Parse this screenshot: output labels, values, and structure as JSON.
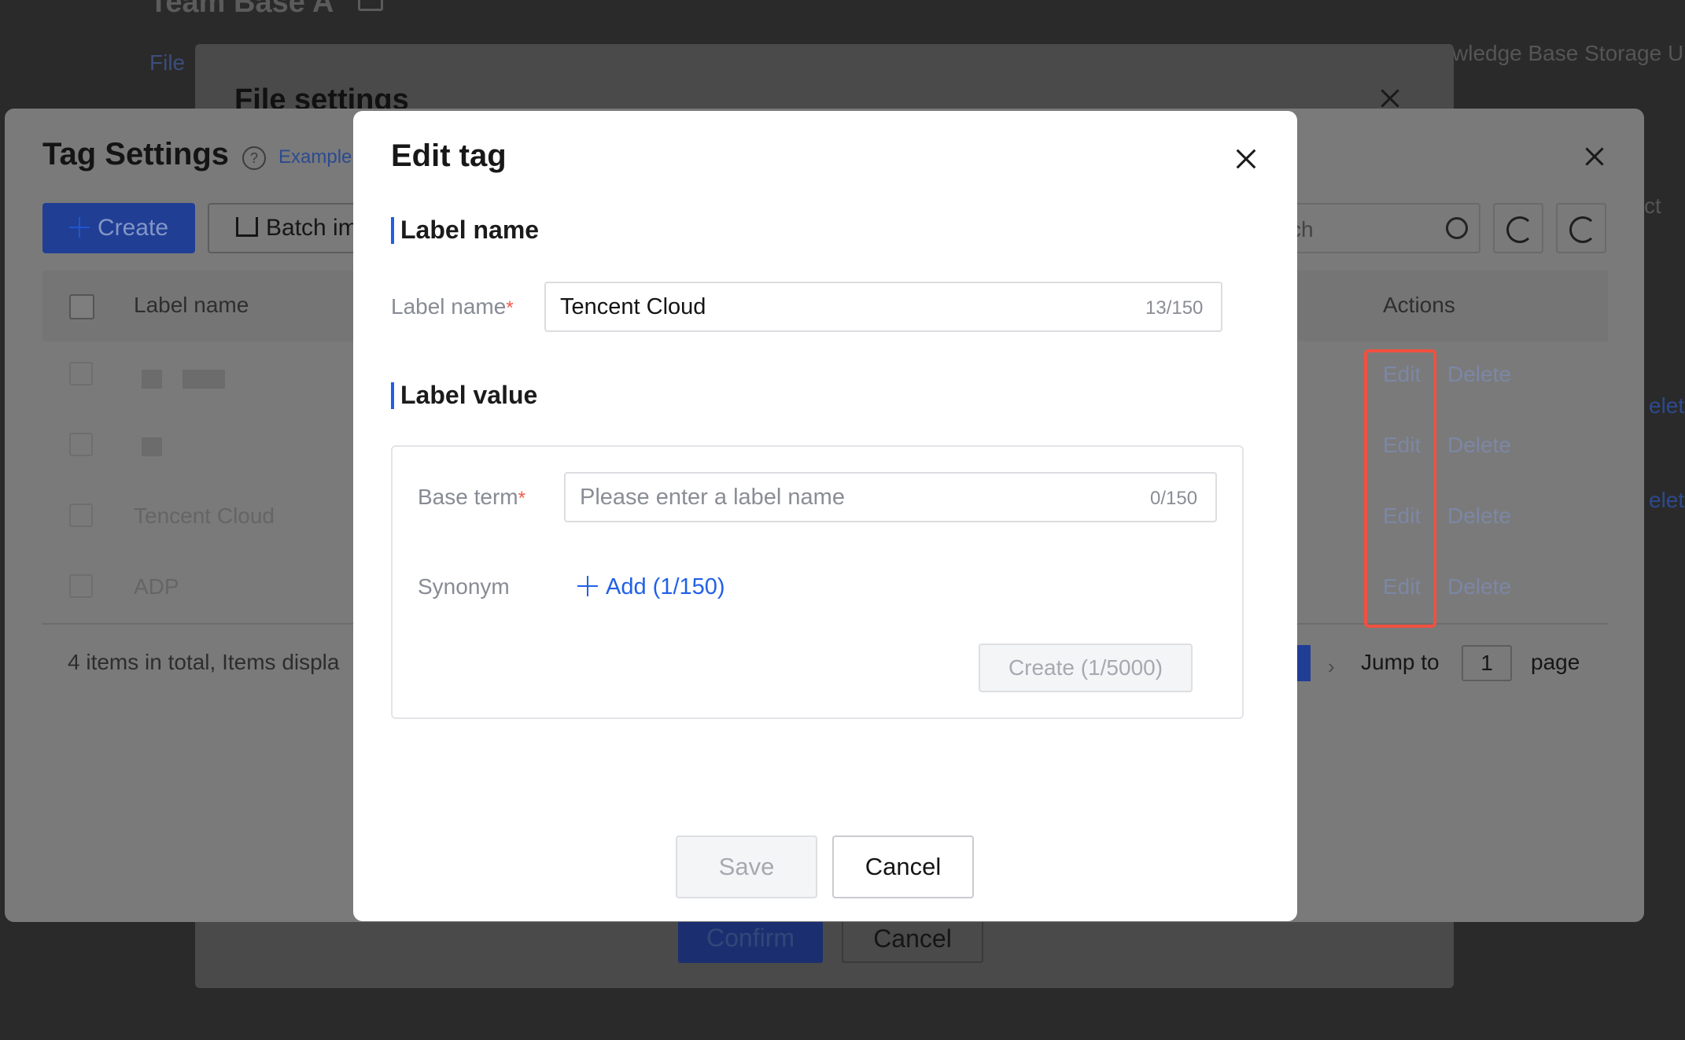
{
  "background": {
    "page_title": "Team Base A",
    "tab_file": "File",
    "right_text": "wledge Base Storage U"
  },
  "file_settings": {
    "title": "File settings",
    "confirm_label": "Confirm",
    "cancel_label": "Cancel"
  },
  "tag_settings": {
    "title": "Tag Settings",
    "help_glyph": "?",
    "example_link": "Example",
    "create_label": "Create",
    "batch_label": "Batch im",
    "search_placeholder": "ch",
    "right_edge_text": "ct",
    "columns": {
      "label_name": "Label name",
      "actions": "Actions"
    },
    "rows": [
      {
        "label": "",
        "edit": "Edit",
        "delete": "Delete"
      },
      {
        "label": "",
        "edit": "Edit",
        "delete": "Delete"
      },
      {
        "label": "Tencent Cloud",
        "edit": "Edit",
        "delete": "Delete"
      },
      {
        "label": "ADP",
        "edit": "Edit",
        "delete": "Delete"
      }
    ],
    "total_text": "4 items in total, Items displa",
    "jump_to": "Jump to",
    "jump_value": "1",
    "page_label": "page",
    "page_next_glyph": "›",
    "edge_links": [
      "elete",
      "elete"
    ]
  },
  "edit_tag": {
    "title": "Edit tag",
    "section_label_name": "Label name",
    "label_name_field_label": "Label name",
    "label_name_value": "Tencent Cloud",
    "label_name_count": "13/150",
    "section_label_value": "Label value",
    "base_term_label": "Base term",
    "base_term_placeholder": "Please enter a label name",
    "base_term_count": "0/150",
    "synonym_label": "Synonym",
    "add_synonym_label": "Add (1/150)",
    "create_value_label": "Create (1/5000)",
    "save_label": "Save",
    "cancel_label": "Cancel",
    "required_mark": "*"
  },
  "colors": {
    "accent": "#2160e8",
    "highlight": "#f1503f",
    "required": "#f05a4a"
  },
  "icons": [
    "close-icon",
    "help-icon",
    "plus-icon",
    "import-icon",
    "search-icon",
    "refresh-icon",
    "chevron-right-icon"
  ]
}
